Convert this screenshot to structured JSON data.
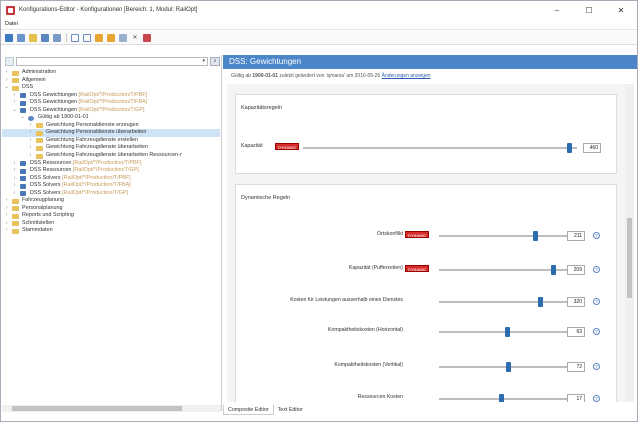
{
  "window": {
    "title": "Konfigurations-Editor - Konfigurationen [Bereich: 1, Modul: RailOpt]",
    "controls": {
      "minimize": "–",
      "maximize": "☐",
      "close": "✕"
    }
  },
  "menubar": {
    "items": [
      "Datei"
    ]
  },
  "tree": {
    "nodes": [
      {
        "indent": 0,
        "twisty": "›",
        "icon": "folder",
        "label": "Administration",
        "sub": ""
      },
      {
        "indent": 0,
        "twisty": "›",
        "icon": "folder",
        "label": "Allgemein",
        "sub": ""
      },
      {
        "indent": 0,
        "twisty": "⌄",
        "icon": "folder",
        "label": "DSS",
        "sub": ""
      },
      {
        "indent": 1,
        "twisty": "›",
        "icon": "doc",
        "label": "DSS Gewichtungen",
        "sub": "[RailOpt/*/Production/T/PBF]"
      },
      {
        "indent": 1,
        "twisty": "›",
        "icon": "doc",
        "label": "DSS Gewichtungen",
        "sub": "[RailOpt/*/Production/T/FBA]"
      },
      {
        "indent": 1,
        "twisty": "⌄",
        "icon": "doc",
        "label": "DSS Gewichtungen",
        "sub": "[RailOpt/*/Production/T/GP]"
      },
      {
        "indent": 2,
        "twisty": "⌄",
        "icon": "time",
        "label": "Gültig ab 1900-01-01",
        "sub": ""
      },
      {
        "indent": 3,
        "twisty": "›",
        "icon": "folder",
        "label": "Gewichtung Personaldienste erzeugen",
        "sub": ""
      },
      {
        "indent": 3,
        "twisty": "›",
        "icon": "folder",
        "label": "Gewichtung Personaldienste überarbeiten",
        "sub": "",
        "selected": true
      },
      {
        "indent": 3,
        "twisty": "›",
        "icon": "folder",
        "label": "Gewichtung Fahrzeugdienste erstellen",
        "sub": ""
      },
      {
        "indent": 3,
        "twisty": "›",
        "icon": "folder",
        "label": "Gewichtung Fahrzeugdienste überarbeiten",
        "sub": ""
      },
      {
        "indent": 3,
        "twisty": "›",
        "icon": "folder",
        "label": "Gewichtung Fahrzeugdienste überarbeiten Ressourcen-r",
        "sub": ""
      },
      {
        "indent": 1,
        "twisty": "›",
        "icon": "doc",
        "label": "DSS Ressourcen",
        "sub": "[RailOpt/*/Production/T/PBF]"
      },
      {
        "indent": 1,
        "twisty": "›",
        "icon": "doc",
        "label": "DSS Ressourcen",
        "sub": "[RailOpt/*/Production/T/GP]"
      },
      {
        "indent": 1,
        "twisty": "›",
        "icon": "doc",
        "label": "DSS Solvers",
        "sub": "[RailOpt/*/Production/T/PBF]"
      },
      {
        "indent": 1,
        "twisty": "›",
        "icon": "doc",
        "label": "DSS Solvers",
        "sub": "[RailOpt/*/Production/T/FBA]"
      },
      {
        "indent": 1,
        "twisty": "›",
        "icon": "doc",
        "label": "DSS Solvers",
        "sub": "[RailOpt/*/Production/T/GP]"
      },
      {
        "indent": 0,
        "twisty": "›",
        "icon": "folder",
        "label": "Fahrzeugplanung",
        "sub": ""
      },
      {
        "indent": 0,
        "twisty": "›",
        "icon": "folder",
        "label": "Personalplanung",
        "sub": ""
      },
      {
        "indent": 0,
        "twisty": "›",
        "icon": "folder",
        "label": "Reports und Scripting",
        "sub": ""
      },
      {
        "indent": 0,
        "twisty": "›",
        "icon": "folder",
        "label": "Schnittstellen",
        "sub": ""
      },
      {
        "indent": 0,
        "twisty": "›",
        "icon": "folder",
        "label": "Stammdaten",
        "sub": ""
      }
    ]
  },
  "editor": {
    "header": "DSS: Gewichtungen",
    "validity": {
      "prefix": "Gültig ab ",
      "date": "1900-01-01",
      "middle": " zuletzt geändert von 'sjmania' am 2016-05-26 ",
      "link": "Änderungen anzeigen"
    },
    "sections": [
      {
        "title": "Kapazitätsregeln"
      },
      {
        "title": "Dynamische Regeln"
      }
    ],
    "badge_text": "DYNAMIC",
    "sliders": [
      {
        "label": "Kapazität",
        "value": "460",
        "level": 0.97,
        "badge": true,
        "info": false
      },
      {
        "label": "Ortskonflikt",
        "value": "211",
        "level": 0.74,
        "badge": true,
        "info": true
      },
      {
        "label": "Kapazität (Pufferzeiten)",
        "value": "209",
        "level": 0.88,
        "badge": true,
        "info": true
      },
      {
        "label": "Kosten für Leistungen ausserhalb eines Dienstes",
        "value": "320",
        "level": 0.78,
        "badge": false,
        "info": true
      },
      {
        "label": "Kompaktheitskosten (Horizontal)",
        "value": "63",
        "level": 0.52,
        "badge": false,
        "info": true
      },
      {
        "label": "Kompaktheitskosten (Vertikal)",
        "value": "72",
        "level": 0.53,
        "badge": false,
        "info": true
      },
      {
        "label": "Ressourcen Kosten",
        "value": "17",
        "level": 0.48,
        "badge": false,
        "info": true
      }
    ]
  },
  "tabs": [
    "Composite Editor",
    "Text Editor"
  ]
}
